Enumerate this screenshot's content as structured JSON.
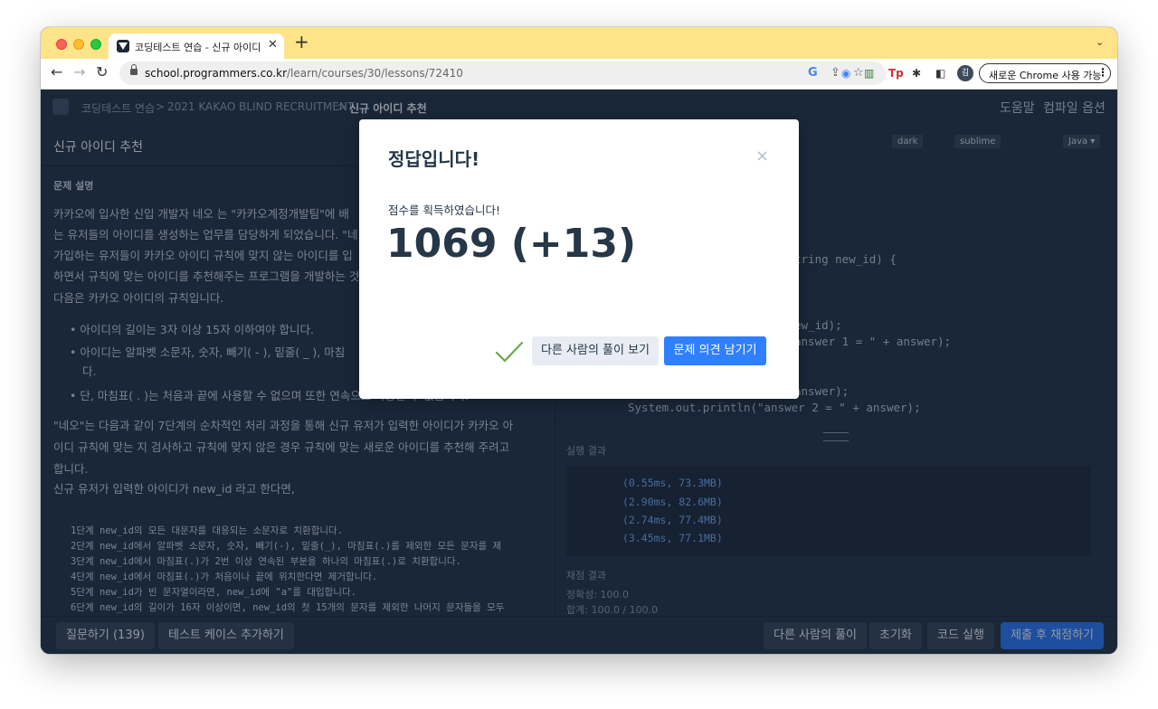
{
  "browser": {
    "tab_title": "코딩테스트 연습 - 신규 아이디 추천",
    "url_host": "school.programmers.co.kr",
    "url_path": "/learn/courses/30/lessons/72410",
    "update_button": "새로운 Chrome 사용 가능",
    "profile_letter": "김"
  },
  "nav": {
    "crumbs": [
      "코딩테스트 연습",
      "2021 KAKAO BLIND RECRUITMENT",
      "신규 아이디 추천"
    ],
    "help": "도움말",
    "compile_options": "컴파일 옵션"
  },
  "problem": {
    "title": "신규 아이디 추천",
    "section": "문제 설명",
    "lines": [
      "카카오에 입사한 신입 개발자 네오 는 \"카카오계정개발팀\"에 배",
      "는 유저들의 아이디를 생성하는 업무를 담당하게 되었습니다. \"네",
      "가입하는 유저들이 카카오 아이디 규칙에 맞지 않는 아이디를 입",
      "하면서 규칙에 맞는 아이디를 추천해주는 프로그램을 개발하는 것",
      "다음은 카카오 아이디의 규칙입니다."
    ],
    "bullets": [
      "• 아이디의 길이는 3자 이상 15자 이하여야 합니다.",
      "• 아이디는 알파벳 소문자, 숫자, 빼기( - ), 밑줄( _ ), 마침",
      "다.",
      "• 단, 마침표( . )는 처음과 끝에 사용할 수 없으며 또한 연속으로 사용할 수 없습니다."
    ],
    "para2": [
      "\"네오\"는 다음과 같이 7단계의 순차적인 처리 과정을 통해 신규 유저가 입력한 아이디가 카카오 아",
      "이디 규칙에 맞는 지 검사하고 규칙에 맞지 않은 경우 규칙에 맞는 새로운 아이디를 추천해 주려고",
      "합니다.",
      "신규 유저가 입력한 아이디가  new_id  라고 한다면,"
    ],
    "steps": [
      "1단계 new_id의 모든 대문자를 대응되는 소문자로 치환합니다.",
      "2단계 new_id에서 알파벳 소문자, 숫자, 빼기(-), 밑줄(_), 마침표(.)를 제외한 모든 문자를 제",
      "3단계 new_id에서 마침표(.)가 2번 이상 연속된 부분을 하나의 마침표(.)로 치환합니다.",
      "4단계 new_id에서 마침표(.)가 처음이나 끝에 위치한다면 제거합니다.",
      "5단계 new_id가 빈 문자열이라면, new_id에 \"a\"를 대입합니다.",
      "6단계 new_id의 길이가 16자 이상이면, new_id의 첫 15개의 문자를 제외한 나머지 문자들을 모두"
    ]
  },
  "editor": {
    "themes": [
      "dark",
      "sublime",
      "Java ▾"
    ],
    "lines": [
      "tring new_id) {",
      "ew_id);",
      "answer 1 = \" + answer);",
      "answer);",
      "    System.out.println(\"answer 2 = \" + answer);"
    ],
    "result_label": "실행 결과",
    "results": [
      "(0.55ms, 73.3MB)",
      "(2.90ms, 82.6MB)",
      "(2.74ms, 77.4MB)",
      "(3.45ms, 77.1MB)"
    ],
    "grade_label": "채점 결과",
    "grade_lines": [
      "정확성: 100.0",
      "합계: 100.0 / 100.0"
    ]
  },
  "bottom": {
    "ask": "질문하기 (139)",
    "add_testcase": "테스트 케이스 추가하기",
    "others": "다른 사람의 풀이",
    "reset": "초기화",
    "run": "코드 실행",
    "submit": "제출 후 채점하기"
  },
  "modal": {
    "title": "정답입니다!",
    "close": "×",
    "subtitle": "점수를 획득하였습니다!",
    "score": "1069 (+13)",
    "btn_others": "다른 사람의 풀이 보기",
    "btn_feedback": "문제 의견 남기기",
    "accent": "#2f7fff",
    "check_color": "#6aa84f"
  }
}
